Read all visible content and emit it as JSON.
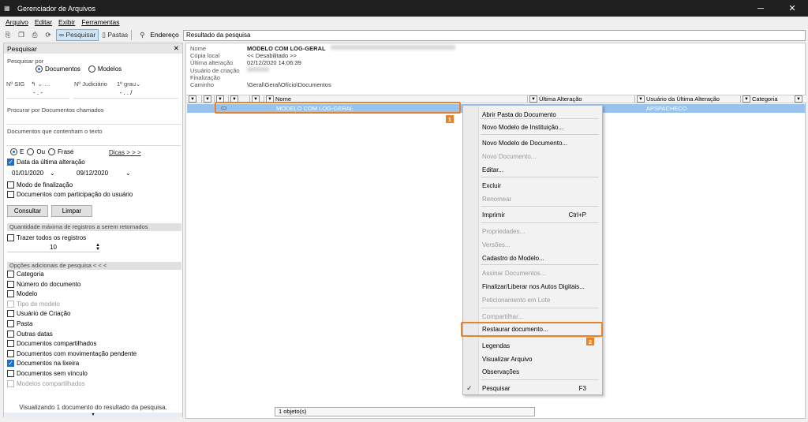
{
  "window": {
    "title": "Gerenciador de Arquivos",
    "minimize": "─",
    "maximize": "☐",
    "close": "✕"
  },
  "menu": [
    "Arquivo",
    "Editar",
    "Exibir",
    "Ferramentas"
  ],
  "toolbar": {
    "search_label": "Pesquisar",
    "folders_label": "Pastas",
    "address_label": "Endereço",
    "address_value": "Resultado da pesquisa"
  },
  "left": {
    "header": "Pesquisar",
    "search_by_label": "Pesquisar por",
    "radio_docs": "Documentos",
    "radio_models": "Modelos",
    "sig_label": "Nº SIG",
    "judicial_label": "Nº Judiciário",
    "degree_label": "1º grau",
    "sig_value": "- . -",
    "judicial_value": "- . . /",
    "called_label": "Procurar por Documentos chamados",
    "containing_label": "Documentos que contenham o texto",
    "op_e": "E",
    "op_ou": "Ou",
    "op_frase": "Frase",
    "tips": "Dicas > > >",
    "last_change_label": "Data da última alteração",
    "date_from": "01/01/2020",
    "date_to": "09/12/2020",
    "finalization_label": "Modo de finalização",
    "participation_label": "Documentos com participação do usuário",
    "consult_btn": "Consultar",
    "clear_btn": "Limpar",
    "max_records_title": "Quantidade máxima de registros a serem retornados",
    "all_records_label": "Trazer todos os registros",
    "max_value": "10",
    "options_title": "Opções adicionais de pesquisa < < <",
    "options": [
      {
        "label": "Categoria",
        "checked": false,
        "disabled": false
      },
      {
        "label": "Número do documento",
        "checked": false,
        "disabled": false
      },
      {
        "label": "Modelo",
        "checked": false,
        "disabled": false
      },
      {
        "label": "Tipo de modelo",
        "checked": false,
        "disabled": true
      },
      {
        "label": "Usuário de Criação",
        "checked": false,
        "disabled": false
      },
      {
        "label": "Pasta",
        "checked": false,
        "disabled": false
      },
      {
        "label": "Outras datas",
        "checked": false,
        "disabled": false
      },
      {
        "label": "Documentos compartilhados",
        "checked": false,
        "disabled": false
      },
      {
        "label": "Documentos com movimentação pendente",
        "checked": false,
        "disabled": false
      },
      {
        "label": "Documentos na lixeira",
        "checked": true,
        "disabled": false
      },
      {
        "label": "Documentos sem vínculo",
        "checked": false,
        "disabled": false
      },
      {
        "label": "Modelos compartilhados",
        "checked": false,
        "disabled": true
      }
    ],
    "footer": "Visualizando 1 documento do resultado da pesquisa."
  },
  "info": {
    "rows": [
      {
        "k": "Nome",
        "v": "MODELO COM LOG-GERAL"
      },
      {
        "k": "Cópia local",
        "v": "<< Desabilitado >>"
      },
      {
        "k": "Última alteração",
        "v": "02/12/2020 14:06:39"
      },
      {
        "k": "Usuário de criação",
        "v": ""
      },
      {
        "k": "Finalização",
        "v": ""
      },
      {
        "k": "Caminho",
        "v": "\\Geral\\Geral\\Ofício\\Documentos"
      }
    ]
  },
  "columns": {
    "name": "Nome",
    "last_change": "Última Alteração",
    "last_user": "Usuário da Última Alteração",
    "category": "Categoria"
  },
  "row": {
    "name": "MODELO COM LOG-GERAL",
    "user": "APSPACHECO"
  },
  "context_menu": [
    {
      "label": "Abrir Pasta do Documento",
      "disabled": false,
      "shortcut": ""
    },
    {
      "label": "Novo Modelo de Instituição...",
      "disabled": false,
      "shortcut": ""
    },
    {
      "label": "Novo Modelo de Documento...",
      "disabled": false,
      "shortcut": ""
    },
    {
      "label": "Novo Documento...",
      "disabled": true,
      "shortcut": ""
    },
    {
      "label": "Editar...",
      "disabled": false,
      "shortcut": ""
    },
    {
      "label": "Excluir",
      "disabled": false,
      "shortcut": ""
    },
    {
      "label": "Renomear",
      "disabled": true,
      "shortcut": ""
    },
    {
      "label": "Imprimir",
      "disabled": false,
      "shortcut": "Ctrl+P"
    },
    {
      "label": "Propriedades...",
      "disabled": true,
      "shortcut": ""
    },
    {
      "label": "Versões...",
      "disabled": true,
      "shortcut": ""
    },
    {
      "label": "Cadastro do Modelo...",
      "disabled": false,
      "shortcut": ""
    },
    {
      "label": "Assinar Documentos...",
      "disabled": true,
      "shortcut": ""
    },
    {
      "label": "Finalizar/Liberar nos Autos Digitais...",
      "disabled": false,
      "shortcut": ""
    },
    {
      "label": "Peticionamento em Lote",
      "disabled": true,
      "shortcut": ""
    },
    {
      "label": "Compartilhar...",
      "disabled": true,
      "shortcut": ""
    },
    {
      "label": "Restaurar documento...",
      "disabled": false,
      "shortcut": ""
    },
    {
      "label": "Legendas",
      "disabled": false,
      "shortcut": ""
    },
    {
      "label": "Visualizar Arquivo",
      "disabled": false,
      "shortcut": ""
    },
    {
      "label": "Observações",
      "disabled": false,
      "shortcut": ""
    },
    {
      "label": "Pesquisar",
      "disabled": false,
      "shortcut": "F3"
    }
  ],
  "badges": {
    "one": "1",
    "two": "2"
  },
  "status": "1 objeto(s)",
  "accent": "#e8832d",
  "selection_color": "#99c3ed"
}
